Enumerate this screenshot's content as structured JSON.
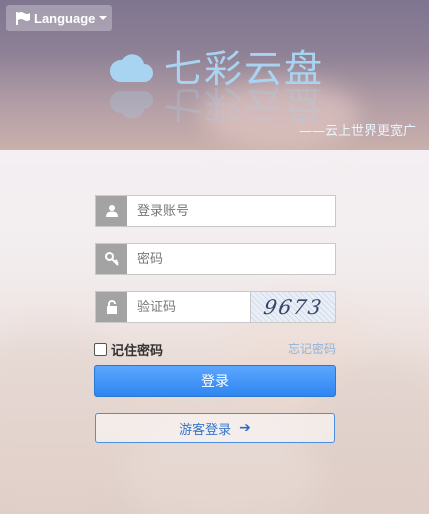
{
  "language": {
    "label": "Language",
    "flag_icon": "flag-icon",
    "caret_icon": "caret-down-icon"
  },
  "brand": {
    "title": "七彩云盘",
    "slogan": "——云上世界更宽广",
    "logo_icon": "cloud-icon",
    "color": "#a8d4f2"
  },
  "form": {
    "account_placeholder": "登录账号",
    "password_placeholder": "密码",
    "captcha_placeholder": "验证码",
    "captcha_text": "9673",
    "remember_label": "记住密码",
    "forgot_label": "忘记密码",
    "login_label": "登录",
    "guest_label": "游客登录",
    "icons": {
      "account": "user-icon",
      "password": "key-icon",
      "captcha": "lock-icon",
      "guest_arrow": "arrow-right-icon"
    }
  },
  "colors": {
    "primary": "#2f86f0",
    "link": "#8fb3d9",
    "addon": "#a3a3a3"
  }
}
